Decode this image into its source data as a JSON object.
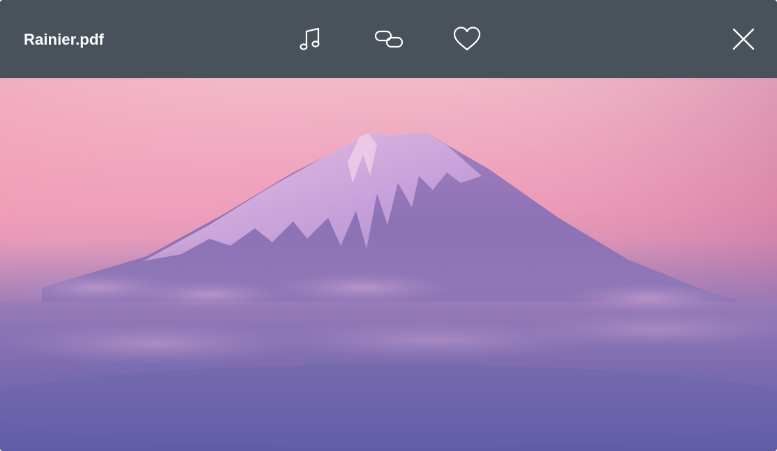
{
  "viewer": {
    "file_name": "Rainier.pdf",
    "toolbar": {
      "music_icon": "music-note-icon",
      "link_icon": "link-icon",
      "favorite_icon": "heart-icon",
      "close_icon": "close-icon"
    },
    "image": {
      "subject_icon": "mountain-photo"
    }
  },
  "colors": {
    "topbar": "#49525b",
    "icon": "#ffffff",
    "sky_top": "#f2b8c8",
    "sky_mid": "#e98fb0",
    "clouds": "#8b72b3",
    "bottom": "#5f5ba3"
  }
}
